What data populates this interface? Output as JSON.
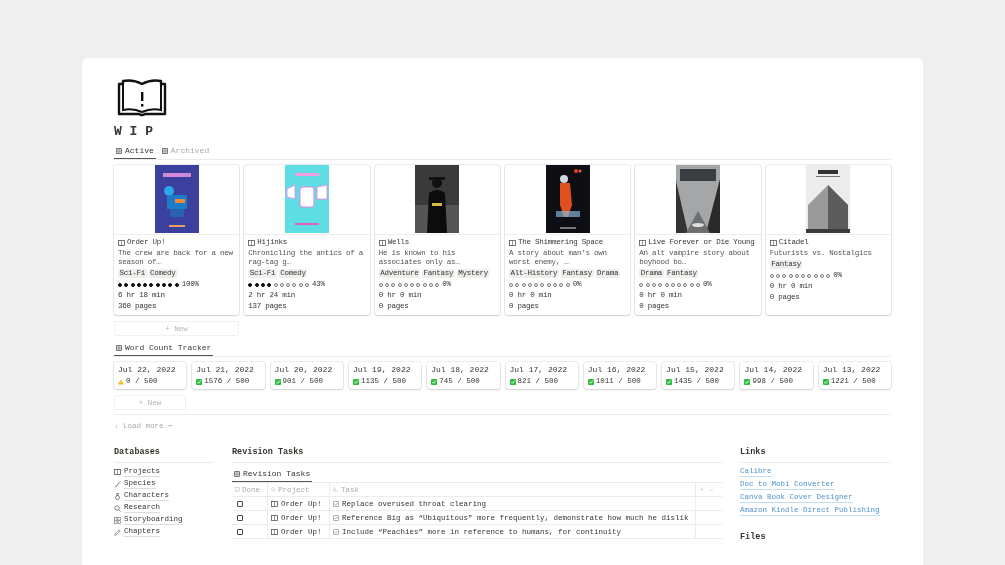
{
  "page": {
    "title": "W I P"
  },
  "gallery": {
    "tabs": [
      {
        "label": "Active",
        "selected": true
      },
      {
        "label": "Archived",
        "selected": false
      }
    ],
    "cards": [
      {
        "title": "Order Up!",
        "description": "The crew are back for a new season of…",
        "tags": [
          "Sci-Fi",
          "Comedy"
        ],
        "stars": 10,
        "progress": "100%",
        "time": "6 hr 18 min",
        "pages": "360 pages"
      },
      {
        "title": "Hijinks",
        "description": "Chronicling the antics of a rag-tag g…",
        "tags": [
          "Sci-Fi",
          "Comedy"
        ],
        "stars": 4,
        "progress": "43%",
        "time": "2 hr 24 min",
        "pages": "137 pages"
      },
      {
        "title": "Wells",
        "description": "He is known to his associates only as…",
        "tags": [
          "Adventure",
          "Fantasy",
          "Mystery"
        ],
        "stars": 0,
        "progress": "0%",
        "time": "0 hr 0 min",
        "pages": "0 pages"
      },
      {
        "title": "The Shimmering Space",
        "description": "A story about man's own worst enemy, …",
        "tags": [
          "Alt-History",
          "Fantasy",
          "Drama"
        ],
        "stars": 0,
        "progress": "0%",
        "time": "0 hr 0 min",
        "pages": "0 pages"
      },
      {
        "title": "Live Forever or Die Young",
        "description": "An alt vampire story about boyhood bo…",
        "tags": [
          "Drama",
          "Fantasy"
        ],
        "stars": 0,
        "progress": "0%",
        "time": "0 hr 0 min",
        "pages": "0 pages"
      },
      {
        "title": "Citadel",
        "description": "Futurists vs. Nostalgics",
        "tags": [
          "Fantasy"
        ],
        "stars": 0,
        "progress": "0%",
        "time": "0 hr 0 min",
        "pages": "0 pages"
      }
    ],
    "new_button": "+ New"
  },
  "tracker": {
    "tab": {
      "label": "Word Count Tracker",
      "selected": true
    },
    "entries": [
      {
        "date": "Jul 22, 2022",
        "kind": "warning",
        "count": "0 / 500"
      },
      {
        "date": "Jul 21, 2022",
        "kind": "done",
        "count": "1576 / 500"
      },
      {
        "date": "Jul 20, 2022",
        "kind": "done",
        "count": "901 / 500"
      },
      {
        "date": "Jul 19, 2022",
        "kind": "done",
        "count": "1135 / 500"
      },
      {
        "date": "Jul 18, 2022",
        "kind": "done",
        "count": "745 / 500"
      },
      {
        "date": "Jul 17, 2022",
        "kind": "done",
        "count": "821 / 500"
      },
      {
        "date": "Jul 16, 2022",
        "kind": "done",
        "count": "1011 / 500"
      },
      {
        "date": "Jul 15, 2022",
        "kind": "done",
        "count": "1435 / 500"
      },
      {
        "date": "Jul 14, 2022",
        "kind": "done",
        "count": "998 / 500"
      },
      {
        "date": "Jul 13, 2022",
        "kind": "done",
        "count": "1221 / 500"
      }
    ],
    "new_button": "+ New",
    "load_more": "↓ Load more ⋯"
  },
  "databases": {
    "heading": "Databases",
    "items": [
      {
        "label": "Projects",
        "kind": "book"
      },
      {
        "label": "Species",
        "kind": "quill"
      },
      {
        "label": "Characters",
        "kind": "flask"
      },
      {
        "label": "Research",
        "kind": "search"
      },
      {
        "label": "Storyboarding",
        "kind": "grid"
      },
      {
        "label": "Chapters",
        "kind": "pencil"
      }
    ]
  },
  "revision": {
    "heading": "Revision Tasks",
    "tab": {
      "label": "Revision Tasks",
      "selected": true
    },
    "columns": [
      "Done",
      "Project",
      "Task"
    ],
    "actions": [
      "+",
      "⋯"
    ],
    "rows": [
      {
        "done": false,
        "project": "Order Up!",
        "task": "Replace overused throat clearing"
      },
      {
        "done": false,
        "project": "Order Up!",
        "task": "Reference Big as “Ubiquitous” more frequently, demonstrate how much he dislik"
      },
      {
        "done": false,
        "project": "Order Up!",
        "task": "Include “Peachies” more in reference to humans, for continuity"
      }
    ]
  },
  "links": {
    "heading": "Links",
    "items": [
      "Calibre",
      "Doc to Mobi Converter",
      "Canva Book Cover Designer",
      "Amazon Kindle Direct Publishing"
    ]
  },
  "files": {
    "heading": "Files"
  }
}
